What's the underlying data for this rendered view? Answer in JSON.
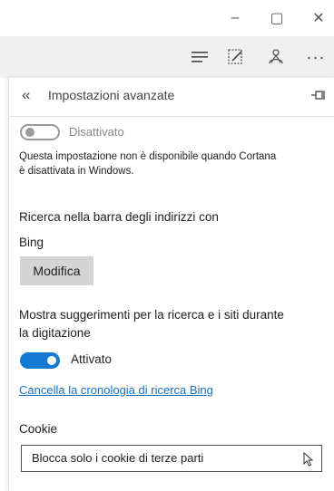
{
  "window": {
    "minimize_glyph": "–",
    "maximize_glyph": "▢",
    "close_glyph": "✕"
  },
  "toolbar": {
    "icons": [
      "hub-icon",
      "web-note-icon",
      "share-icon",
      "more-icon"
    ],
    "more_glyph": "···"
  },
  "panel": {
    "back_glyph": "«",
    "title": "Impostazioni avanzate",
    "pin_glyph": "⊸"
  },
  "cortana": {
    "toggle_label": "Disattivato",
    "toggle_on": false,
    "note_line1": "Questa impostazione non è disponibile quando Cortana",
    "note_line2": "è disattivata in Windows."
  },
  "search": {
    "label": "Ricerca nella barra degli indirizzi con",
    "engine": "Bing",
    "change_button": "Modifica"
  },
  "suggestions": {
    "label_line1": "Mostra suggerimenti per la ricerca e i siti durante",
    "label_line2": "la digitazione",
    "toggle_label": "Attivato",
    "toggle_on": true
  },
  "history": {
    "clear_link": "Cancella la cronologia di ricerca Bing"
  },
  "cookies": {
    "label": "Cookie",
    "selected": "Blocca solo i cookie di terze parti"
  },
  "colors": {
    "accent": "#1479d0",
    "link": "#1a6fbf",
    "button_gray": "#d4d4d4",
    "toolbar_bg": "#f0f0f0"
  }
}
